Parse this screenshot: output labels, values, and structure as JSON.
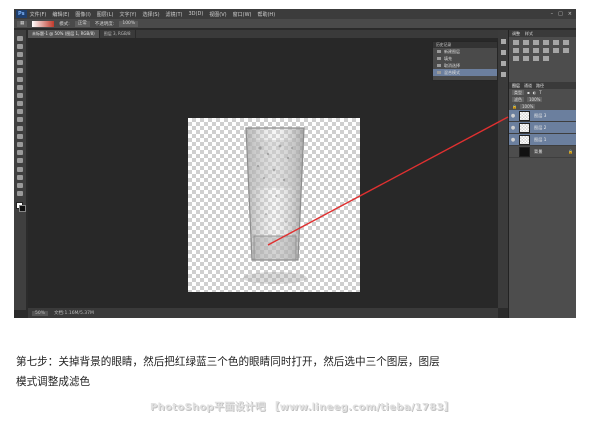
{
  "app": {
    "logo": "Ps",
    "menus": [
      "文件(F)",
      "编辑(E)",
      "图像(I)",
      "图层(L)",
      "文字(Y)",
      "选择(S)",
      "滤镜(T)",
      "3D(D)",
      "视图(V)",
      "窗口(W)",
      "帮助(H)"
    ]
  },
  "options_bar": {
    "mode_label": "模式:",
    "mode_value": "正常",
    "opacity_label": "不透明度:",
    "opacity_value": "100%"
  },
  "document": {
    "tabs": [
      "未标题-1 @ 50% (图层 1, RGB/8)",
      "图层 3, RGB/8"
    ]
  },
  "status_bar": {
    "zoom": "50%",
    "doc_info": "文档:1.16M/5.37M"
  },
  "history_panel": {
    "header": "历史记录",
    "items": [
      "新建图层",
      "填充",
      "取消选择",
      "混合模式"
    ]
  },
  "right_panel": {
    "adjust_tab": "调整",
    "styles_tab": "样式",
    "layers_tab": "图层",
    "channels_tab": "通道",
    "paths_tab": "路径",
    "kind_label": "类型",
    "blend_mode": "滤色",
    "opacity": "100%",
    "fill": "100%",
    "layers": [
      {
        "name": "图层 3",
        "visible": true,
        "selected": true
      },
      {
        "name": "图层 2",
        "visible": true,
        "selected": true
      },
      {
        "name": "图层 1",
        "visible": true,
        "selected": true
      },
      {
        "name": "背景",
        "visible": false,
        "selected": false
      }
    ]
  },
  "colors": {
    "arrow": "#e03030",
    "selected_layer": "#6b7f9e"
  },
  "caption": {
    "line1": "第七步：关掉背景的眼睛，然后把红绿蓝三个色的眼睛同时打开，然后选中三个图层，图层",
    "line2": "模式调整成滤色"
  },
  "watermark": "PhotoShop平面设计吧 【www.lineeg.com/tieba/1783】"
}
